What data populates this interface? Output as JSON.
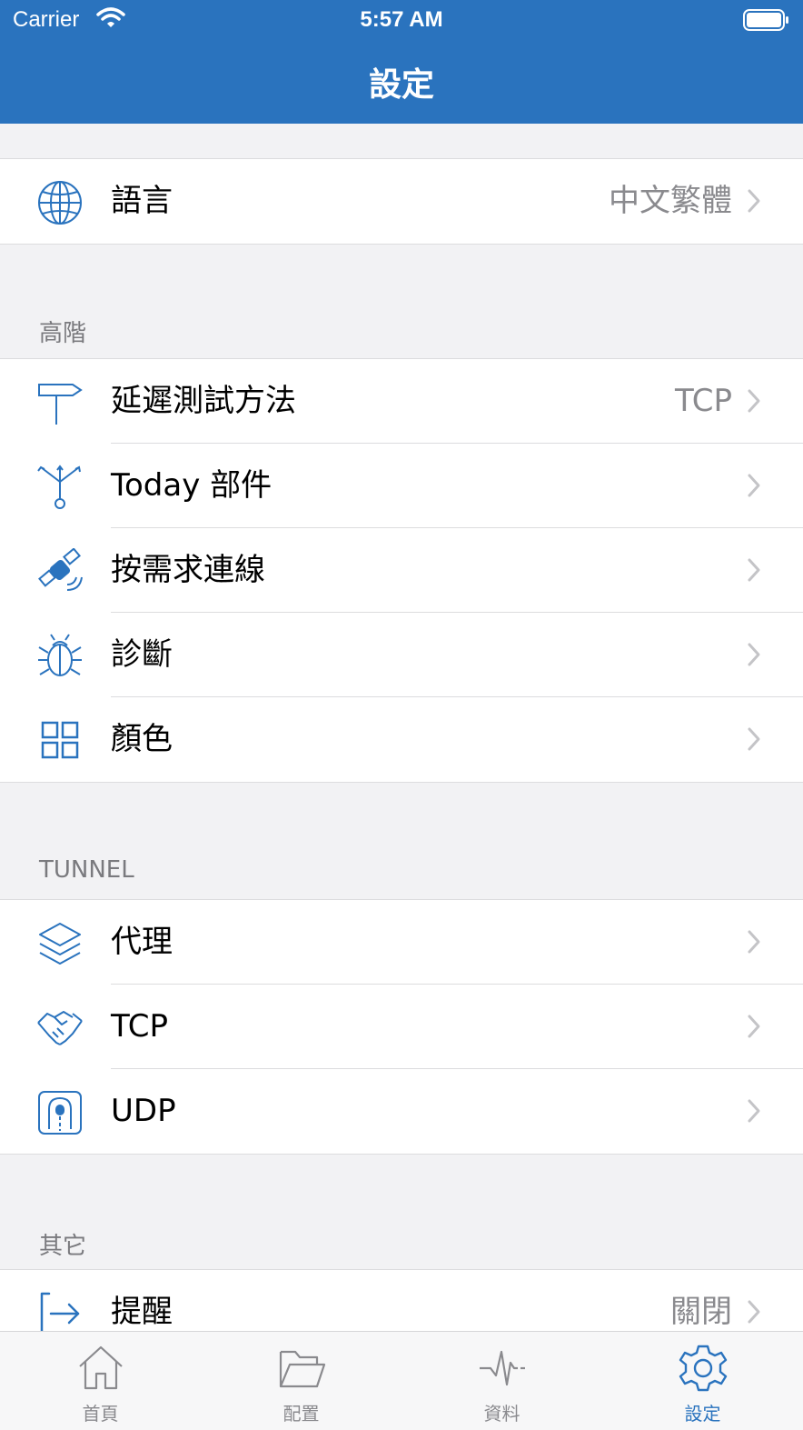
{
  "status": {
    "carrier": "Carrier",
    "time": "5:57 AM"
  },
  "nav": {
    "title": "設定"
  },
  "language": {
    "label": "語言",
    "value": "中文繁體",
    "icon": "globe-icon"
  },
  "advanced": {
    "header": "高階",
    "items": [
      {
        "label": "延遲測試方法",
        "value": "TCP",
        "icon": "signpost-icon"
      },
      {
        "label": "Today 部件",
        "value": "",
        "icon": "antenna-icon"
      },
      {
        "label": "按需求連線",
        "value": "",
        "icon": "satellite-icon"
      },
      {
        "label": "診斷",
        "value": "",
        "icon": "bug-icon"
      },
      {
        "label": "顏色",
        "value": "",
        "icon": "grid-icon"
      }
    ]
  },
  "tunnel": {
    "header": "TUNNEL",
    "items": [
      {
        "label": "代理",
        "icon": "layers-icon"
      },
      {
        "label": "TCP",
        "icon": "handshake-icon"
      },
      {
        "label": "UDP",
        "icon": "tunnel-icon"
      }
    ]
  },
  "other": {
    "header": "其它",
    "items": [
      {
        "label": "提醒",
        "value": "關閉",
        "icon": "exit-icon"
      }
    ]
  },
  "tabs": [
    {
      "label": "首頁",
      "icon": "home-icon"
    },
    {
      "label": "配置",
      "icon": "folder-icon"
    },
    {
      "label": "資料",
      "icon": "activity-icon"
    },
    {
      "label": "設定",
      "icon": "gear-icon"
    }
  ],
  "colors": {
    "accent": "#2a73be",
    "background": "#f2f2f4",
    "secondary_text": "#8a8a8e"
  }
}
